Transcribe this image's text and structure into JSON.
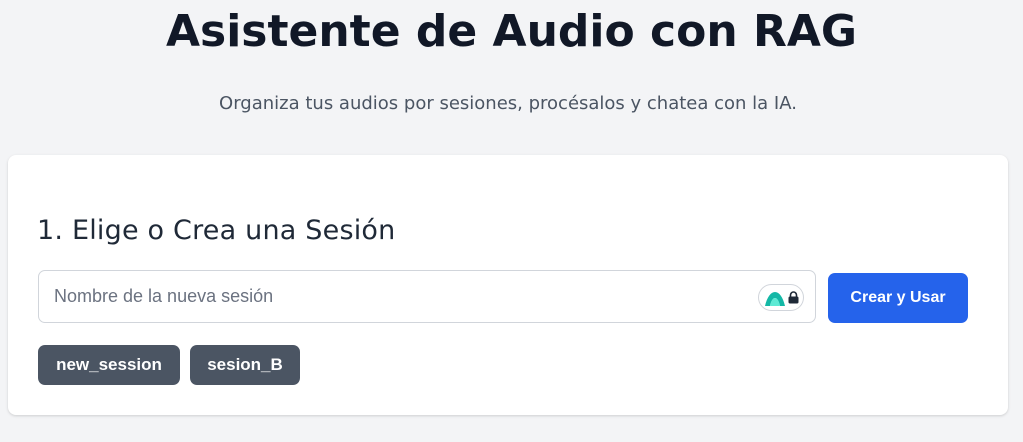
{
  "header": {
    "title": "Asistente de Audio con RAG",
    "subtitle": "Organiza tus audios por sesiones, procésalos y chatea con la IA."
  },
  "session_section": {
    "heading": "1. Elige o Crea una Sesión",
    "input": {
      "placeholder": "Nombre de la nueva sesión",
      "value": ""
    },
    "extension_badge_icons": [
      "mountain-logo-icon",
      "lock-icon"
    ],
    "create_button_label": "Crear y Usar",
    "sessions": [
      {
        "label": "new_session"
      },
      {
        "label": "sesion_B"
      }
    ]
  },
  "colors": {
    "background": "#f3f4f6",
    "card": "#ffffff",
    "primary_button": "#2563eb",
    "session_chip": "#4b5563",
    "badge_logo": "#14b8a6"
  }
}
